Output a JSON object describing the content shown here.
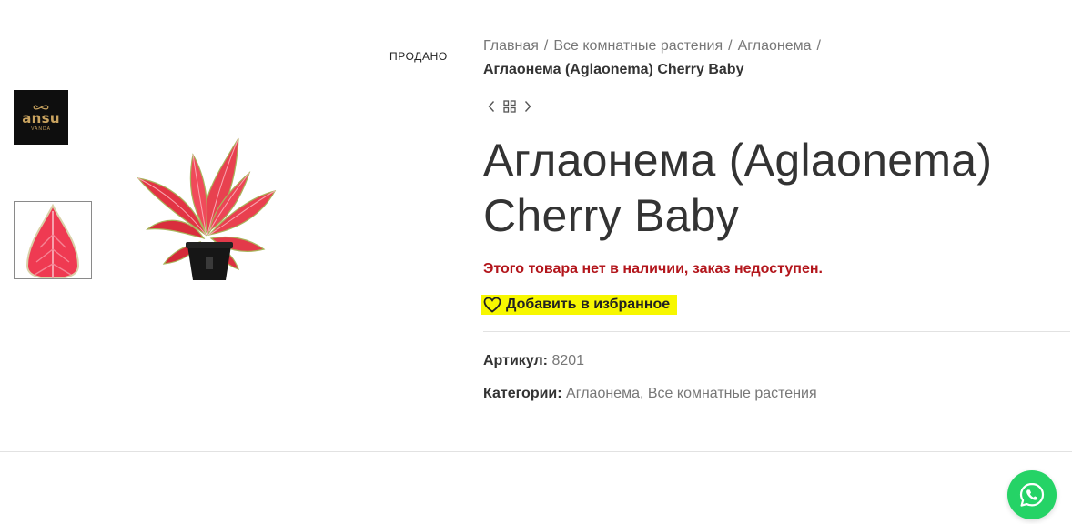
{
  "gallery": {
    "sold_badge": "ПРОДАНО",
    "logo": {
      "brand": "ansu",
      "subtitle": "VANDA"
    }
  },
  "breadcrumb": {
    "home": "Главная",
    "all": "Все комнатные растения",
    "genus": "Аглаонема",
    "separator": "/",
    "current": "Аглаонема (Aglaonema) Cherry Baby"
  },
  "product": {
    "title": "Аглаонема (Aglaonema) Cherry Baby",
    "stock_note": "Этого товара нет в наличии, заказ недоступен.",
    "wishlist_label": "Добавить в избранное",
    "sku_key": "Артикул:",
    "sku_value": "8201",
    "categories_key": "Категории:",
    "category_1": "Аглаонема",
    "category_sep": ",",
    "category_2": "Все комнатные растения"
  },
  "icons": {
    "prev": "chevron-left-icon",
    "grid": "grid-icon",
    "next": "chevron-right-icon",
    "wishlist": "heart-icon",
    "chat": "whatsapp-icon"
  },
  "colors": {
    "stock_note": "#b3161c",
    "highlight": "#f7f700",
    "whatsapp": "#25d366",
    "logo_gold": "#c9a35f"
  }
}
